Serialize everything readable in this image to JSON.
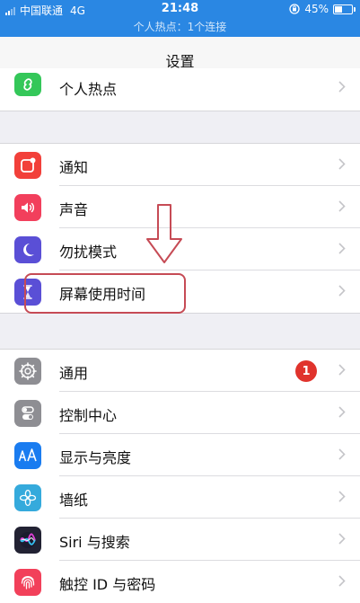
{
  "status_bar": {
    "carrier": "中国联通",
    "network": "4G",
    "time": "21:48",
    "battery": "45%",
    "battery_level": 0.45,
    "hotspot_text": "个人热点：1个连接"
  },
  "nav": {
    "title": "设置"
  },
  "groups": [
    {
      "rows": [
        {
          "label": "个人热点",
          "icon": "personal-hotspot-icon",
          "icon_color": "#34c759"
        }
      ]
    },
    {
      "rows": [
        {
          "label": "通知",
          "icon": "notifications-icon",
          "icon_color": "#f2403a"
        },
        {
          "label": "声音",
          "icon": "sounds-icon",
          "icon_color": "#f23f5c"
        },
        {
          "label": "勿扰模式",
          "icon": "do-not-disturb-icon",
          "icon_color": "#5a4fd6"
        },
        {
          "label": "屏幕使用时间",
          "icon": "screen-time-icon",
          "icon_color": "#5a4fd6"
        }
      ]
    },
    {
      "rows": [
        {
          "label": "通用",
          "icon": "general-icon",
          "icon_color": "#8e8e93",
          "badge": "1"
        },
        {
          "label": "控制中心",
          "icon": "control-center-icon",
          "icon_color": "#8e8e93"
        },
        {
          "label": "显示与亮度",
          "icon": "display-brightness-icon",
          "icon_color": "#1a7cf0"
        },
        {
          "label": "墙纸",
          "icon": "wallpaper-icon",
          "icon_color": "#35aadc"
        },
        {
          "label": "Siri 与搜索",
          "icon": "siri-icon",
          "icon_color": "#222233"
        },
        {
          "label": "触控 ID 与密码",
          "icon": "touch-id-icon",
          "icon_color": "#f2405a"
        }
      ]
    }
  ],
  "colors": {
    "status_bar_bg": "#2a87e3",
    "badge": "#e0332c",
    "annotation": "#c64b55"
  }
}
